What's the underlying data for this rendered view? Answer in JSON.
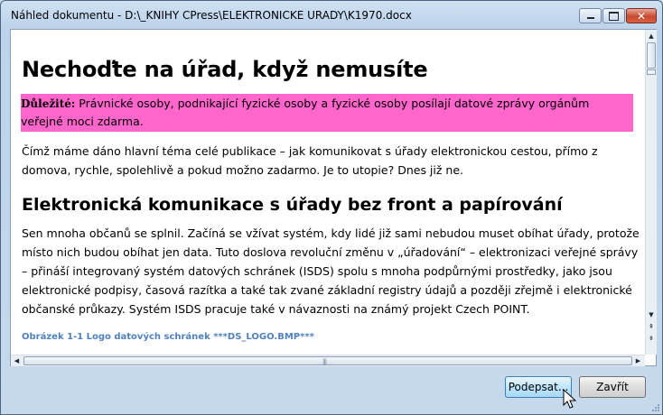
{
  "window": {
    "title": "Náhled dokumentu - D:\\_KNIHY CPress\\ELEKTRONICKE URADY\\K1970.docx",
    "controls": {
      "minimize": "minimize",
      "maximize": "maximize",
      "close": "✕"
    }
  },
  "document": {
    "heading1": "Nechoďte na úřad, když nemusíte",
    "note_label": "Důležité:",
    "note_text": " Právnické osoby, podnikající fyzické osoby a fyzické osoby posílají datové zprávy orgánům veřejné moci zdarma.",
    "paragraph1": "Čímž máme dáno hlavní téma celé publikace – jak komunikovat s úřady elektronickou cestou, přímo z domova, rychle, spolehlivě a pokud možno zadarmo. Je to utopie? Dnes již ne.",
    "heading2": "Elektronická komunikace s úřady bez front a papírování",
    "paragraph2": "Sen mnoha občanů se splnil. Začíná se vžívat systém, kdy lidé již sami nebudou muset obíhat úřady, protože místo nich budou obíhat jen data. Tuto doslova revoluční změnu v „úřadování“ – elektronizaci veřejné správy – přináší integrovaný systém datových schránek (ISDS) spolu s mnoha podpůrnými prostředky, jako jsou elektronické podpisy, časová razítka a také tak zvané základní registry údajů a později zřejmě i elektronické občanské průkazy. Systém ISDS pracuje také v návaznosti na známý projekt Czech POINT.",
    "caption": "Obrázek 1-1 Logo datových schránek ***DS_LOGO.BMP***",
    "highlight_color": "#ff66cc",
    "caption_color": "#4f81bd"
  },
  "buttons": {
    "sign": "Podepsat...",
    "close": "Zavřít"
  },
  "icons": {
    "scroll_up": "▲",
    "scroll_down": "▼",
    "page_up": "⇞",
    "page_down": "⇟",
    "scroll_left": "◀",
    "scroll_right": "▶",
    "grip": "|||"
  }
}
